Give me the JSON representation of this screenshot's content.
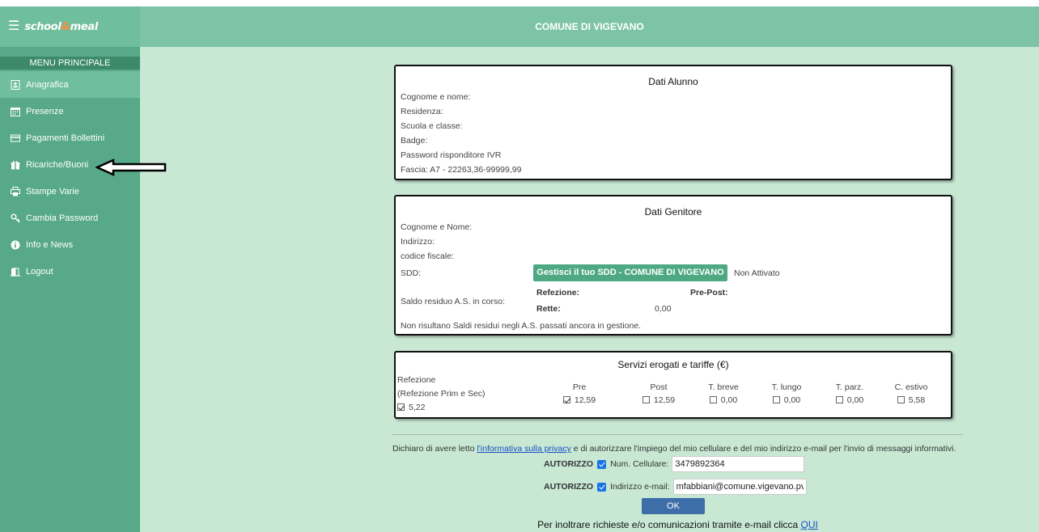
{
  "brand": {
    "prefix": "school",
    "amp": "&",
    "suffix": "meal"
  },
  "header": {
    "title": "COMUNE DI VIGEVANO"
  },
  "sidebar": {
    "section_title": "MENU PRINCIPALE",
    "items": [
      {
        "label": "Anagrafica",
        "icon": "id-card-icon",
        "active": true
      },
      {
        "label": "Presenze",
        "icon": "calendar-icon"
      },
      {
        "label": "Pagamenti Bollettini",
        "icon": "credit-card-icon"
      },
      {
        "label": "Ricariche/Buoni",
        "icon": "gift-icon"
      },
      {
        "label": "Stampe Varie",
        "icon": "printer-icon"
      },
      {
        "label": "Cambia Password",
        "icon": "key-icon"
      },
      {
        "label": "Info e News",
        "icon": "info-icon"
      },
      {
        "label": "Logout",
        "icon": "logout-icon"
      }
    ]
  },
  "student": {
    "title": "Dati Alunno",
    "fields": [
      "Cognome e nome:",
      "Residenza:",
      "Scuola e classe:",
      "Badge:",
      "Password risponditore IVR",
      "Fascia:  A7 - 22263,36-99999,99"
    ]
  },
  "parent": {
    "title": "Dati Genitore",
    "name_label": "Cognome e Nome:",
    "address_label": "Indirizzo:",
    "fiscal_label": "codice fiscale:",
    "sdd_label": "SDD:",
    "sdd_button": "Gestisci il tuo SDD - COMUNE DI VIGEVANO",
    "sdd_status": "Non Attivato",
    "balance_label": "Saldo residuo A.S. in corso:",
    "refezione_label": "Refezione:",
    "prepost_label": "Pre-Post:",
    "rette_label": "Rette:",
    "rette_value": "0,00",
    "note": "Non risultano Saldi residui negli A.S. passati ancora in gestione."
  },
  "services": {
    "title": "Servizi erogati e tariffe (€)",
    "refezione_label": "Refezione",
    "refezione_sub": "(Refezione Prim e Sec)",
    "refezione_value": "5,22",
    "items": [
      {
        "label": "Pre",
        "value": "12,59",
        "checked": true
      },
      {
        "label": "Post",
        "value": "12,59",
        "checked": false
      },
      {
        "label": "T. breve",
        "value": "0,00",
        "checked": false
      },
      {
        "label": "T. lungo",
        "value": "0,00",
        "checked": false
      },
      {
        "label": "T. parz.",
        "value": "0,00",
        "checked": false
      },
      {
        "label": "C. estivo",
        "value": "5,58",
        "checked": false
      }
    ]
  },
  "consent": {
    "text_before": "Dichiaro di avere letto ",
    "link": "l'informativa sulla privacy",
    "text_after": " e di autorizzare l'impiego del mio cellulare e del mio indirizzo e-mail per l'invio di messaggi informativi.",
    "authorize_label": "AUTORIZZO",
    "phone_label": "Num. Cellulare:",
    "phone_value": "3479892364",
    "email_label": "Indirizzo e-mail:",
    "email_value": "mfabbiani@comune.vigevano.pv.",
    "ok_label": "OK",
    "contact_text": "Per inoltrare richieste e/o comunicazioni tramite e-mail clicca ",
    "contact_link": "QUI"
  }
}
